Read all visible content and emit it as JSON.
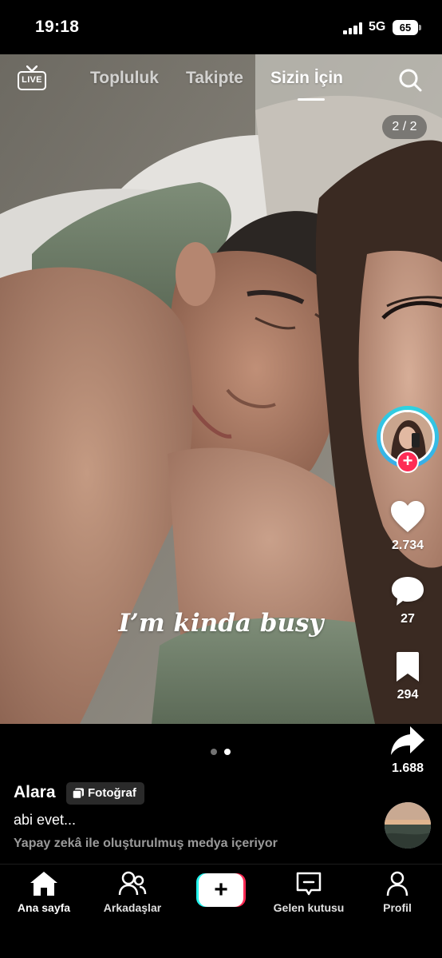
{
  "status_bar": {
    "time": "19:18",
    "network": "5G",
    "battery": "65"
  },
  "top_nav": {
    "live_label": "LIVE",
    "tabs": [
      {
        "label": "Topluluk",
        "active": false
      },
      {
        "label": "Takipte",
        "active": false
      },
      {
        "label": "Sizin İçin",
        "active": true
      }
    ],
    "search_icon": "search-icon"
  },
  "post": {
    "pager": "2 / 2",
    "overlay_text": "I’m kinda busy",
    "slide_count": 2,
    "current_slide": 2,
    "author": "Alara",
    "badge_label": "Fotoğraf",
    "caption": "abi evet...",
    "ai_label": "Yapay zekâ ile oluşturulmuş medya içeriyor"
  },
  "actions": {
    "likes": "2.734",
    "comments": "27",
    "saves": "294",
    "shares": "1.688"
  },
  "bottom_nav": {
    "items": [
      {
        "label": "Ana sayfa",
        "icon": "home-icon",
        "active": true
      },
      {
        "label": "Arkadaşlar",
        "icon": "friends-icon",
        "active": false
      },
      {
        "label": "",
        "icon": "create-icon",
        "active": false
      },
      {
        "label": "Gelen kutusu",
        "icon": "inbox-icon",
        "active": false
      },
      {
        "label": "Profil",
        "icon": "profile-icon",
        "active": false
      }
    ]
  },
  "colors": {
    "accent_red": "#fe2c55",
    "accent_cyan": "#25f4ee",
    "ring": "#2fd3e0",
    "background": "#000000"
  }
}
